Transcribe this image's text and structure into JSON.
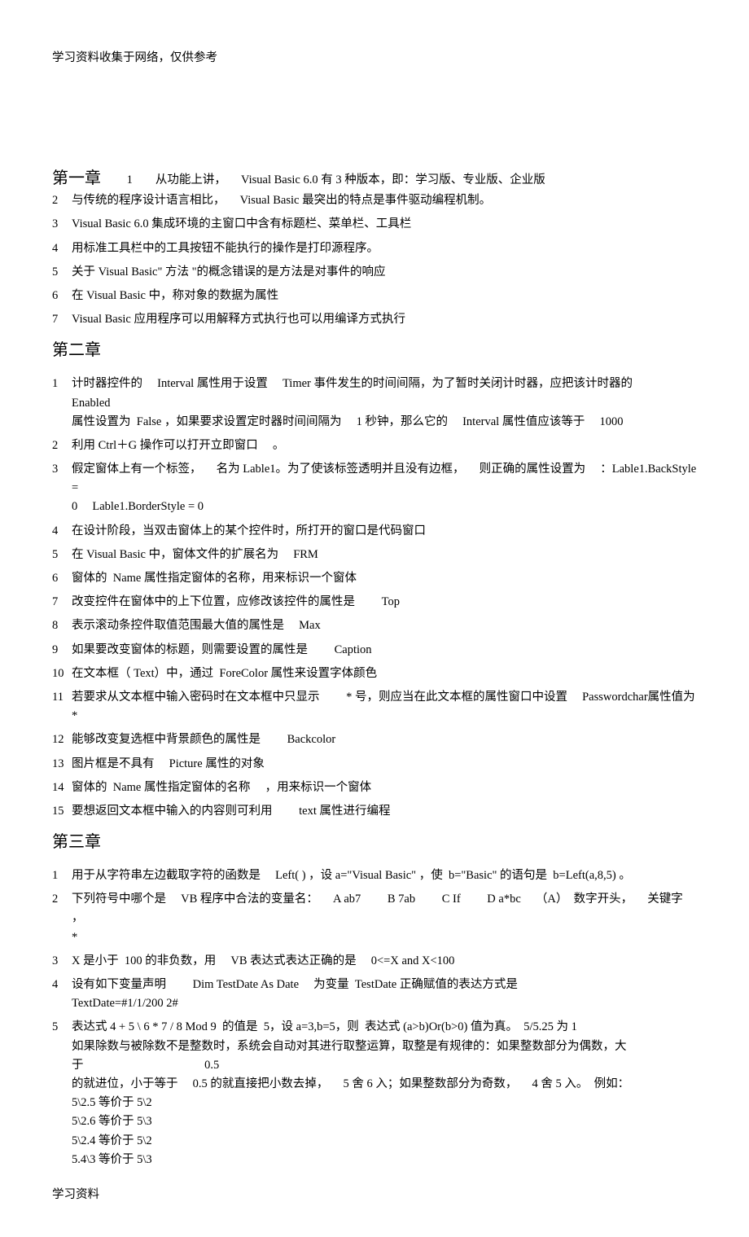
{
  "header_note": "学习资料收集于网络，仅供参考",
  "footer": "学习资料",
  "chapter1": {
    "title": "第一章",
    "items": [
      "从功能上讲，  Visual Basic 6.0  有 3 种版本，即：学习版、专业版、企业版",
      "与传统的程序设计语言相比，  Visual Basic 最突出的特点是事件驱动编程机制。",
      "Visual Basic 6.0 集成环境的主窗口中含有标题栏、菜单栏、工具栏",
      "用标准工具栏中的工具按钮不能执行的操作是打印源程序。",
      "关于 Visual Basic\" 方法 \"的概念错误的是方法是对事件的响应",
      "在 Visual Basic 中，称对象的数据为属性",
      "Visual Basic 应用程序可以用解释方式执行也可以用编译方式执行"
    ]
  },
  "chapter2": {
    "title": "第二章",
    "items": [
      "计时器控件的  Interval 属性用于设置  Timer 事件发生的时间间隔，为了暂时关闭计时器，应把该计时器的    Enabled\n属性设置为  False ，如果要求设置定时器时间间隔为  1 秒钟，那么它的  Interval 属性值应该等于  1000",
      "利用 Ctrl＋G 操作可以打开立即窗口  。",
      "假定窗体上有一个标签，  名为 Lable1。为了使该标签透明并且没有边框，  则正确的属性设置为  ：Lable1.BackStyle =\n0  Lable1.BorderStyle = 0",
      "在设计阶段，当双击窗体上的某个控件时，所打开的窗口是代码窗口",
      "在 Visual Basic 中，窗体文件的扩展名为  FRM",
      "窗体的  Name 属性指定窗体的名称，用来标识一个窗体",
      "改变控件在窗体中的上下位置，应修改该控件的属性是   Top",
      "表示滚动条控件取值范围最大值的属性是  Max",
      "如果要改变窗体的标题，则需要设置的属性是   Caption",
      "在文本框（ Text）中，通过  ForeColor 属性来设置字体颜色",
      "若要求从文本框中输入密码时在文本框中只显示   * 号，则应当在此文本框的属性窗口中设置  Passwordchar属性值为 *",
      "能够改变复选框中背景颜色的属性是   Backcolor",
      "图片框是不具有  Picture 属性的对象",
      "窗体的  Name 属性指定窗体的名称  ，用来标识一个窗体",
      "要想返回文本框中输入的内容则可利用   text 属性进行编程"
    ]
  },
  "chapter3": {
    "title": "第三章",
    "items": [
      "用于从字符串左边截取字符的函数是  Left( ) ，设 a=\"Visual Basic\" ，使  b=\"Basic\" 的语句是  b=Left(a,8,5) 。",
      "下列符号中哪个是  VB 程序中合法的变量名：  A ab7   B 7ab   C If   D a*bc  （A）  数字开头，  关键字 ，\n*",
      "X 是小于  100 的非负数，用  VB 表达式表达正确的是  0<=X and X<100",
      "设有如下变量声明   Dim TestDate As Date  为变量  TestDate 正确赋值的表达方式是\nTextDate=#1/1/200 2#",
      "表达式 4 + 5 \\ 6 * 7 / 8 Mod 9  的值是  5，设 a=3,b=5，则  表达式 (a>b)Or(b>0) 值为真。  5/5.25 为 1\n如果除数与被除数不是整数时，系统会自动对其进行取整运算，取整是有规律的：如果整数部分为偶数，大于           0.5\n的就进位，小于等于  0.5 的就直接把小数去掉，  5 舍 6 入；如果整数部分为奇数，  4 舍 5 入。  例如：\n5\\2.5 等价于 5\\2\n5\\2.6 等价于 5\\3\n5\\2.4 等价于 5\\2\n5.4\\3 等价于 5\\3"
    ]
  }
}
